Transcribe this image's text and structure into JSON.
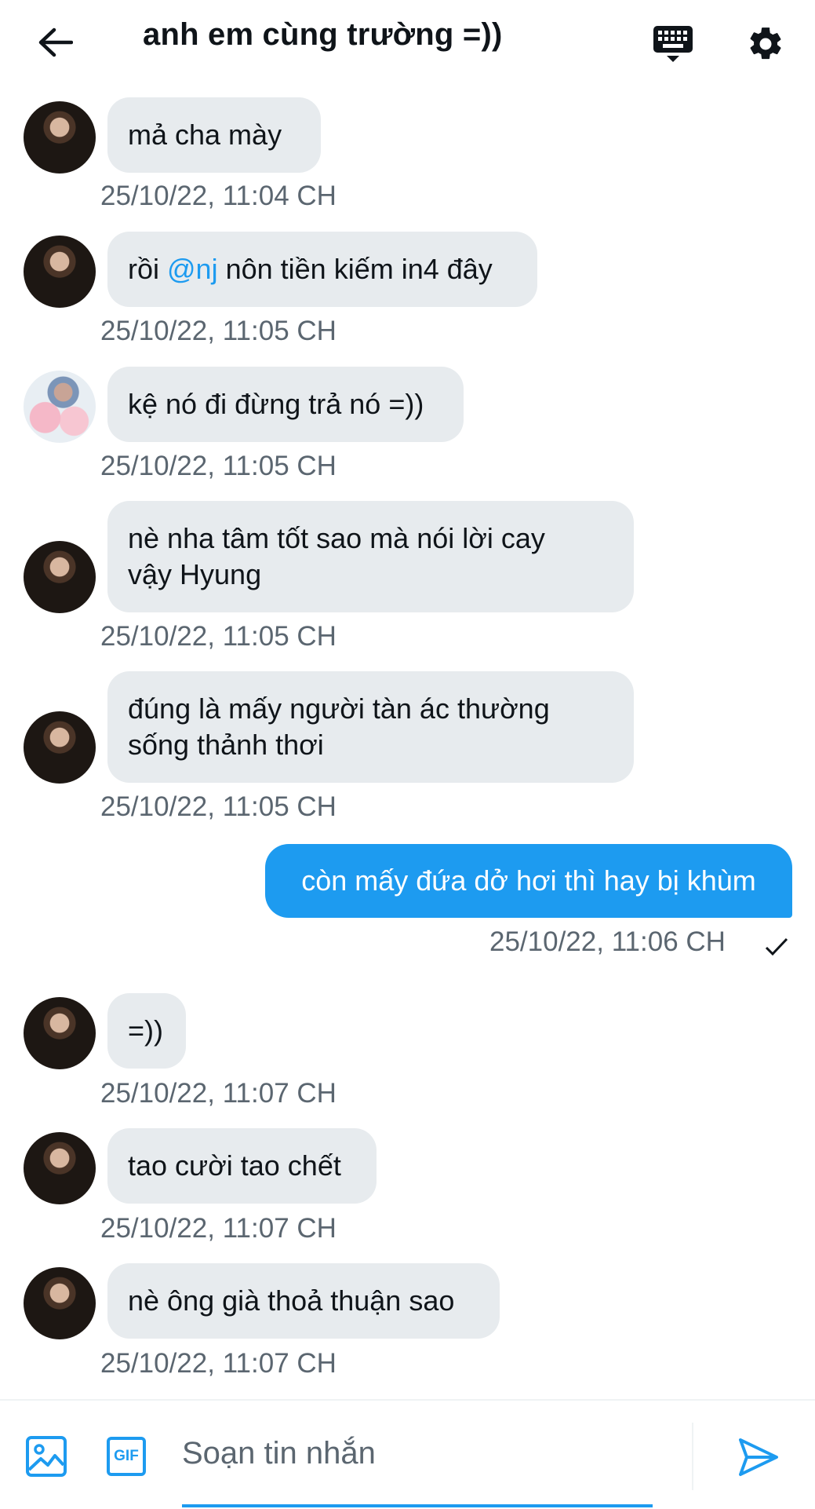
{
  "header": {
    "title": "anh em cùng trường =))",
    "icons": [
      "back-arrow-icon",
      "keyboard-icon",
      "gear-icon"
    ]
  },
  "messages": [
    {
      "text": "mả cha mày",
      "time": "25/10/22, 11:04 CH"
    },
    {
      "pre": "rồi ",
      "mention": "@nj",
      "post": " nôn tiền kiếm in4 đây",
      "time": "25/10/22, 11:05 CH"
    },
    {
      "text": "kệ nó đi đừng trả nó =))",
      "time": "25/10/22, 11:05 CH"
    },
    {
      "line1": "nè nha tâm tốt sao mà nói lời cay",
      "line2": "vậy Hyung",
      "time": "25/10/22, 11:05 CH"
    },
    {
      "line1": "đúng là mấy người tàn ác thường",
      "line2": "sống thảnh thơi",
      "time": "25/10/22, 11:05 CH"
    },
    {
      "text": "còn mấy đứa dở hơi thì hay bị khùm",
      "time": "25/10/22, 11:06 CH",
      "outgoing": true
    },
    {
      "text": "=))",
      "time": "25/10/22, 11:07 CH"
    },
    {
      "text": "tao cười tao chết",
      "time": "25/10/22, 11:07 CH"
    },
    {
      "text": "nè ông già thoả thuận sao",
      "time": "25/10/22, 11:07 CH"
    }
  ],
  "composer": {
    "placeholder": "Soạn tin nhắn",
    "gif_label": "GIF",
    "icons": [
      "image-icon",
      "gif-icon",
      "send-icon"
    ]
  },
  "colors": {
    "accent": "#1d9bf0",
    "bubble_in": "#e7ebee",
    "timestamp": "#5b6670"
  }
}
